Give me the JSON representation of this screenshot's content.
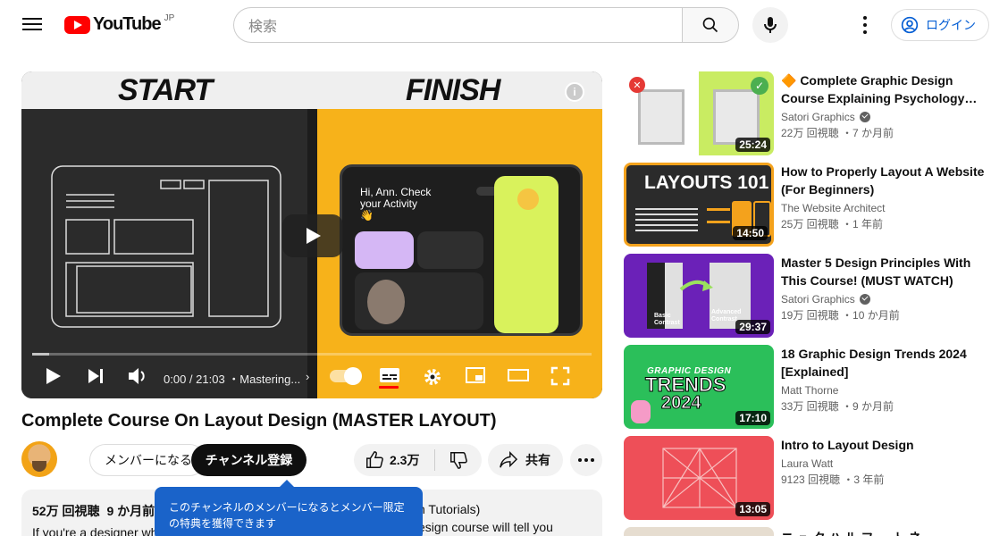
{
  "header": {
    "logo_text": "YouTube",
    "logo_region": "JP",
    "search_placeholder": "検索",
    "login_label": "ログイン"
  },
  "player": {
    "left_caption": "START",
    "right_caption": "FINISH",
    "info_label": "i",
    "tablet_greeting": "Hi, Ann. Check your Activity 👋",
    "time_text": "0:00 / 21:03 ・Mastering...",
    "chapter_chevron": "›",
    "progress": 0.03
  },
  "video": {
    "title": "Complete Course On Layout Design (MASTER LAYOUT)",
    "member_label": "メンバーになる",
    "subscribe_label": "チャンネル登録",
    "like_count": "2.3万",
    "share_label": "共有",
    "views": "52万 回視聴",
    "age": "9 か月前",
    "desc_line": "If you're a designer wh",
    "desc_fragment_1": "n Tutorials)",
    "desc_fragment_2": "esign course will tell you",
    "tooltip": "このチャンネルのメンバーになるとメンバー限定の特典を獲得できます"
  },
  "recommendations": [
    {
      "title": "🔶 Complete Graphic Design Course Explaining Psychology…",
      "channel": "Satori Graphics",
      "verified": true,
      "views": "22万 回視聴",
      "age": "・7 か月前",
      "duration": "25:24"
    },
    {
      "title": "How to Properly Layout A Website (For Beginners)",
      "channel": "The Website Architect",
      "verified": false,
      "views": "25万 回視聴",
      "age": "・1 年前",
      "duration": "14:50",
      "thumb_text": "LAYOUTS 101"
    },
    {
      "title": "Master 5 Design Principles With This Course! (MUST WATCH)",
      "channel": "Satori Graphics",
      "verified": true,
      "views": "19万 回視聴",
      "age": "・10 か月前",
      "duration": "29:37",
      "thumb_left": "Basic Contrast",
      "thumb_right": "Advanced Contrast"
    },
    {
      "title": "18 Graphic Design Trends 2024 [Explained]",
      "channel": "Matt Thorne",
      "verified": false,
      "views": "33万 回視聴",
      "age": "・9 か月前",
      "duration": "17:10",
      "thumb_line1": "GRAPHIC DESIGN",
      "thumb_line2": "TRENDS",
      "thumb_line3": "2024"
    },
    {
      "title": "Intro to Layout Design",
      "channel": "Laura Watt",
      "verified": false,
      "views": "9123 回視聴",
      "age": "・3 年前",
      "duration": "13:05"
    }
  ],
  "partial_rec_title": "ニ ュ ク ハ ル フ ー ト ネ"
}
